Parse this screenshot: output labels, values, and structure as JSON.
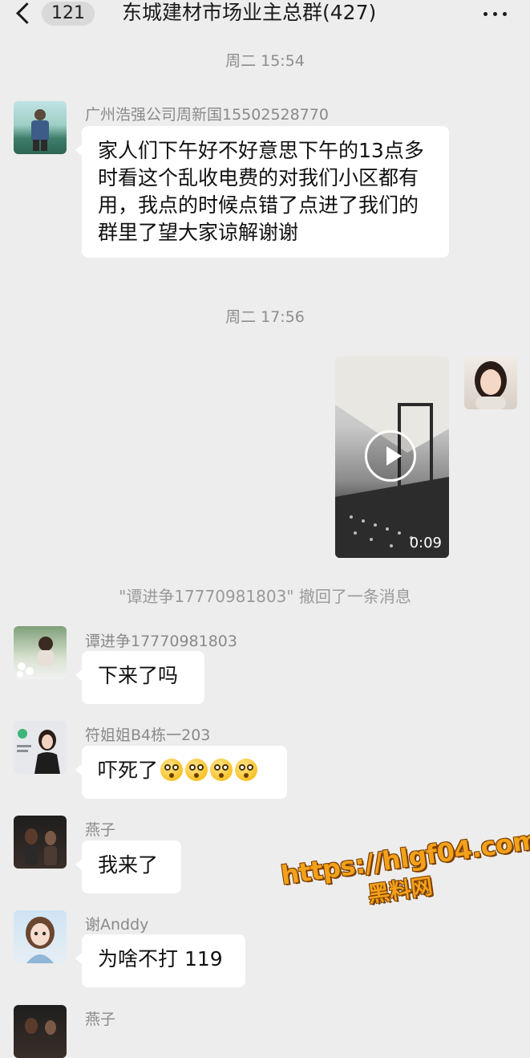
{
  "header": {
    "unread_count": "121",
    "title": "东城建材市场业主总群(427)"
  },
  "messages": [
    {
      "type": "time",
      "text": "周二 15:54"
    },
    {
      "type": "text",
      "sender": "广州浩强公司周新国15502528770",
      "text": "家人们下午好不好意思下午的13点多时看这个乱收电费的对我们小区都有用，我点的时候点错了点进了我们的群里了望大家谅解谢谢"
    },
    {
      "type": "time",
      "text": "周二 17:56"
    },
    {
      "type": "video",
      "from": "self",
      "duration": "0:09"
    },
    {
      "type": "system",
      "text": "\"谭进争17770981803\" 撤回了一条消息"
    },
    {
      "type": "text",
      "sender": "谭进争17770981803",
      "text": "下来了吗"
    },
    {
      "type": "text",
      "sender": "符姐姐B4栋一203",
      "text": "吓死了",
      "emoji": [
        "flushed-face",
        "flushed-face",
        "flushed-face",
        "flushed-face"
      ]
    },
    {
      "type": "text",
      "sender": "燕子",
      "text": "我来了"
    },
    {
      "type": "text",
      "sender": "谢Anddy",
      "text": "为啥不打 119"
    },
    {
      "type": "text",
      "sender": "燕子",
      "text": ""
    }
  ],
  "watermark": {
    "url": "https://hlgf04.com",
    "name": "黑料网"
  },
  "colors": {
    "chat_background": "#ededed",
    "bubble": "#ffffff",
    "watermark": "#f3a11a"
  }
}
